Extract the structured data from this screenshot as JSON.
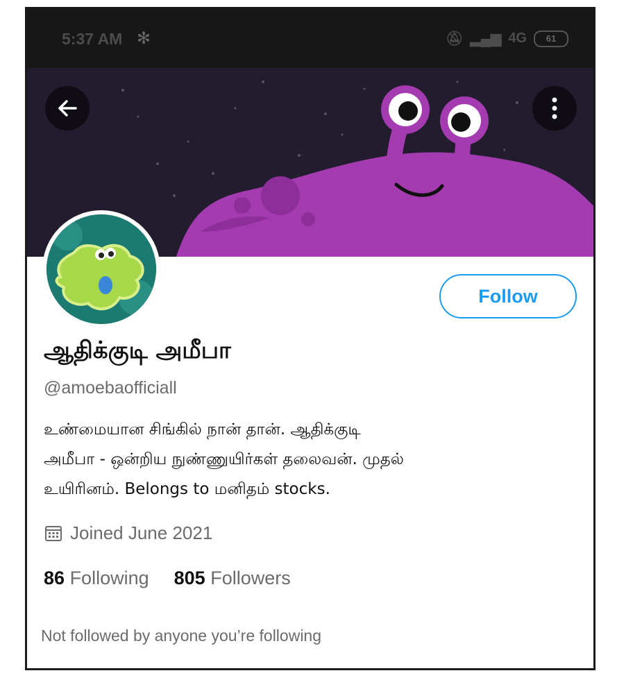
{
  "status_bar": {
    "time": "5:37 AM",
    "network": "4G",
    "battery": "61"
  },
  "profile": {
    "display_name": "ஆதிக்குடி அமீபா",
    "handle": "@amoebaofficiall",
    "follow_label": "Follow",
    "bio_lines": [
      "உண்மையான சிங்கில் நான் தான்.  ஆதிக்குடி",
      "அமீபா - ஒன்றிய நுண்ணுயிர்கள் தலைவன்.  முதல்",
      "உயிரினம்.  Belongs to மனிதம் stocks."
    ],
    "joined": "Joined June 2021",
    "following_count": "86",
    "following_label": "Following",
    "followers_count": "805",
    "followers_label": "Followers",
    "mutuals_note": "Not followed by anyone you’re following"
  },
  "colors": {
    "accent": "#1d9bf0",
    "banner_bg": "#221c2e",
    "creature": "#a43bb0"
  },
  "icons": {
    "back": "back-arrow-icon",
    "more": "more-vertical-icon",
    "calendar": "calendar-icon",
    "bluetooth": "bluetooth-icon",
    "mute": "bell-muted-icon",
    "signal": "signal-icon"
  }
}
